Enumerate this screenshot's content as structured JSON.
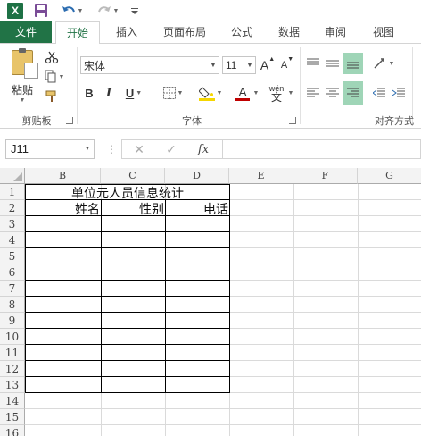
{
  "qat": {
    "app_letter": "X"
  },
  "tabs": [
    "文件",
    "开始",
    "插入",
    "页面布局",
    "公式",
    "数据",
    "审阅",
    "视图"
  ],
  "ribbon": {
    "paste_label": "粘贴",
    "clipboard_label": "剪贴板",
    "font_group_label": "字体",
    "align_group_label": "对齐方式",
    "font_name": "宋体",
    "font_size": "11",
    "bold": "B",
    "italic": "I",
    "underline": "U",
    "grow_font": "A",
    "shrink_font": "A",
    "font_color": "A",
    "phonetic": "wén",
    "phonetic_sub": "文"
  },
  "formula_bar": {
    "name_box": "J11",
    "fx": "fx",
    "cancel": "✕",
    "enter": "✓"
  },
  "sheet": {
    "columns": [
      "B",
      "C",
      "D",
      "E",
      "F",
      "G"
    ],
    "rows": [
      "1",
      "2",
      "3",
      "4",
      "5",
      "6",
      "7",
      "8",
      "9",
      "10",
      "11",
      "12",
      "13",
      "14",
      "15",
      "16"
    ],
    "title": "单位元人员信息统计",
    "headers": [
      "姓名",
      "性别",
      "电话"
    ]
  },
  "colors": {
    "accent": "#217346",
    "highlight_fill": "#f5d600",
    "font_red": "#c00000"
  }
}
